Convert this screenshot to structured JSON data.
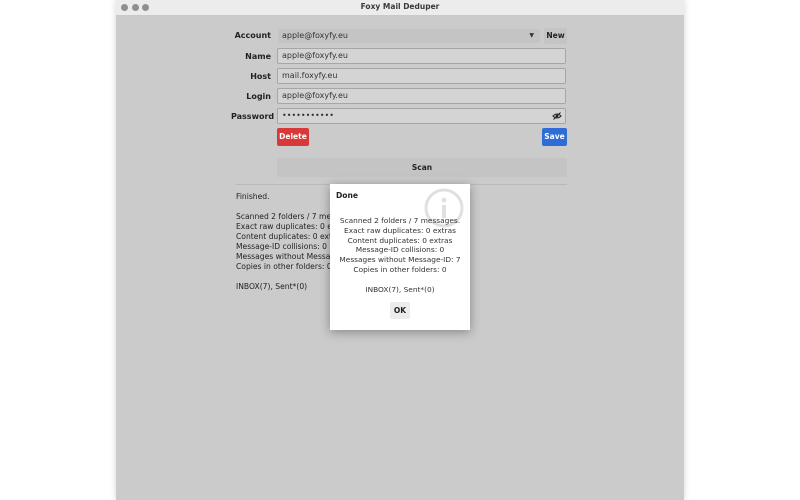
{
  "window": {
    "title": "Foxy Mail Deduper"
  },
  "form": {
    "account_label": "Account",
    "account_value": "apple@foxyfy.eu",
    "new_button": "New",
    "name_label": "Name",
    "name_value": "apple@foxyfy.eu",
    "host_label": "Host",
    "host_value": "mail.foxyfy.eu",
    "login_label": "Login",
    "login_value": "apple@foxyfy.eu",
    "password_label": "Password",
    "password_value": "•••••••••••",
    "delete_button": "Delete",
    "save_button": "Save",
    "scan_button": "Scan"
  },
  "output": {
    "lines": [
      "Finished.",
      "",
      "Scanned 2 folders / 7 messages.",
      "Exact raw duplicates: 0 extras",
      "Content duplicates: 0 extras",
      "Message-ID collisions: 0",
      "Messages without Message-ID: 7",
      "Copies in other folders: 0",
      "",
      "INBOX(7), Sent*(0)"
    ]
  },
  "dialog": {
    "title": "Done",
    "lines": [
      "Scanned 2 folders / 7 messages.",
      "Exact raw duplicates: 0 extras",
      "Content duplicates: 0 extras",
      "Message-ID collisions: 0",
      "Messages without Message-ID: 7",
      "Copies in other folders: 0",
      "",
      "INBOX(7), Sent*(0)"
    ],
    "ok_button": "OK",
    "icon": "info-icon"
  },
  "colors": {
    "delete": "#d93838",
    "save": "#2f6cd6"
  }
}
